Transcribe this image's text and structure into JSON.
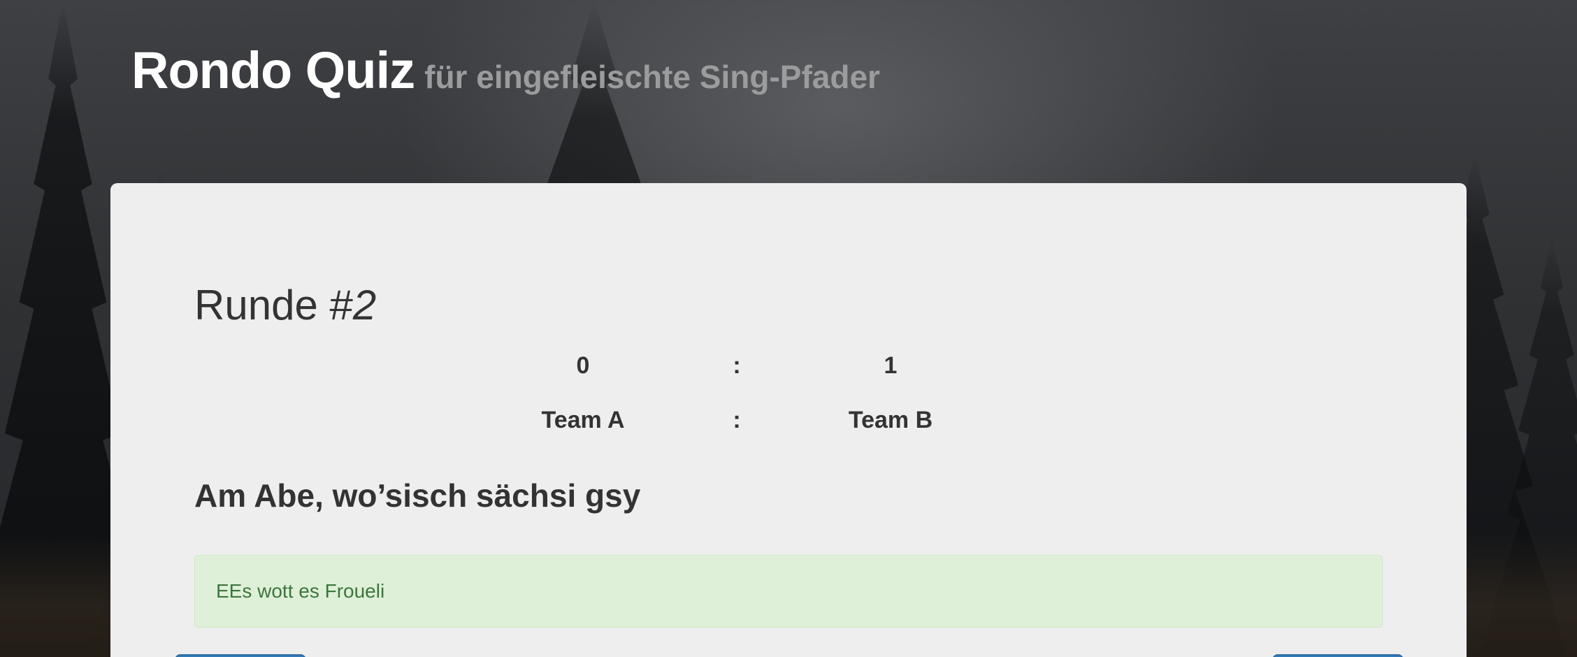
{
  "header": {
    "title": "Rondo Quiz",
    "subtitle": "für eingefleischte Sing-Pfader"
  },
  "round": {
    "label": "Runde #",
    "number": "2"
  },
  "score": {
    "team_a_points": "0",
    "team_b_points": "1",
    "separator": ":",
    "team_a_name": "Team A",
    "team_b_name": "Team B"
  },
  "song": {
    "title": "Am Abe, wo’sisch sächsi gsy"
  },
  "answer": {
    "text": "EEs wott es Froueli"
  },
  "colors": {
    "panel_bg": "#eeeeee",
    "alert_bg": "#dff0d8",
    "alert_text": "#3c763d",
    "button_primary": "#337ab7"
  }
}
